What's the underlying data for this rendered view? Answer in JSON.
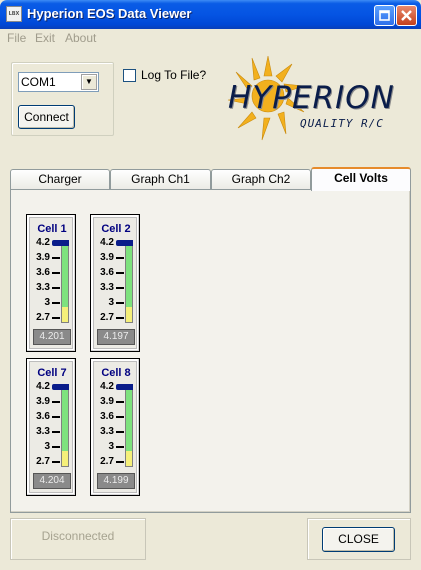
{
  "window": {
    "title": "Hyperion EOS Data Viewer",
    "icon_text": "LBX"
  },
  "menu": [
    "File",
    "Exit",
    "About"
  ],
  "connection": {
    "port": "COM1",
    "connect_label": "Connect"
  },
  "log": {
    "label": "Log To File?",
    "checked": false
  },
  "logo": {
    "brand": "HYPERION",
    "tagline": "QUALITY R/C",
    "colors": {
      "text": "#0a1d4a",
      "sun": "#f2b01e"
    }
  },
  "tabs": [
    "Charger",
    "Graph Ch1",
    "Graph Ch2",
    "Cell Volts"
  ],
  "active_tab": "Cell Volts",
  "cells": [
    {
      "name": "Cell 1",
      "value": "4.201",
      "ticks": [
        "4.2",
        "3.9",
        "3.6",
        "3.3",
        "3",
        "2.7"
      ]
    },
    {
      "name": "Cell 2",
      "value": "4.197",
      "ticks": [
        "4.2",
        "3.9",
        "3.6",
        "3.3",
        "3",
        "2.7"
      ]
    },
    {
      "name": "Cell 7",
      "value": "4.204",
      "ticks": [
        "4.2",
        "3.9",
        "3.6",
        "3.3",
        "3",
        "2.7"
      ]
    },
    {
      "name": "Cell 8",
      "value": "4.199",
      "ticks": [
        "4.2",
        "3.9",
        "3.6",
        "3.3",
        "3",
        "2.7"
      ]
    }
  ],
  "status": "Disconnected",
  "close_label": "CLOSE",
  "colors": {
    "gauge_green": "#7ee27e",
    "gauge_yellow": "#f5f07a",
    "marker": "#0a1d8a",
    "cell_title": "#000080"
  }
}
